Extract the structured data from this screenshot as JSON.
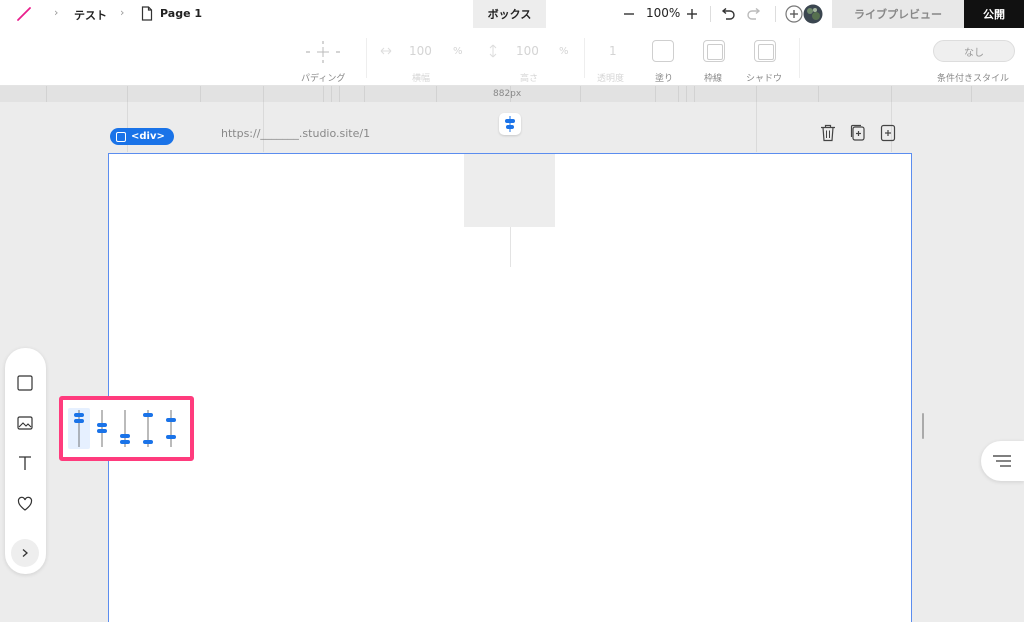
{
  "breadcrumb": {
    "project": "テスト",
    "page": "Page 1"
  },
  "tab": {
    "active": "ボックス"
  },
  "zoom": {
    "value": "100%"
  },
  "topbar": {
    "live_preview": "ライブプレビュー",
    "publish": "公開"
  },
  "props": {
    "padding_label": "パディング",
    "width_value": "100",
    "width_unit": "%",
    "height_value": "100",
    "height_unit": "%",
    "width_label": "横幅",
    "height_label": "高さ",
    "opacity_value": "1",
    "opacity_label": "透明度",
    "fill_label": "塗り",
    "border_label": "枠線",
    "shadow_label": "シャドウ",
    "condition_value": "なし",
    "condition_label": "条件付きスタイル"
  },
  "ruler": {
    "width_label": "882px"
  },
  "canvas": {
    "element_tag": "<div>",
    "url": "https://_______.studio.site/1"
  },
  "colors": {
    "accent": "#1a73e8",
    "highlight": "#ff3b7d",
    "publish_bg": "#111111"
  }
}
